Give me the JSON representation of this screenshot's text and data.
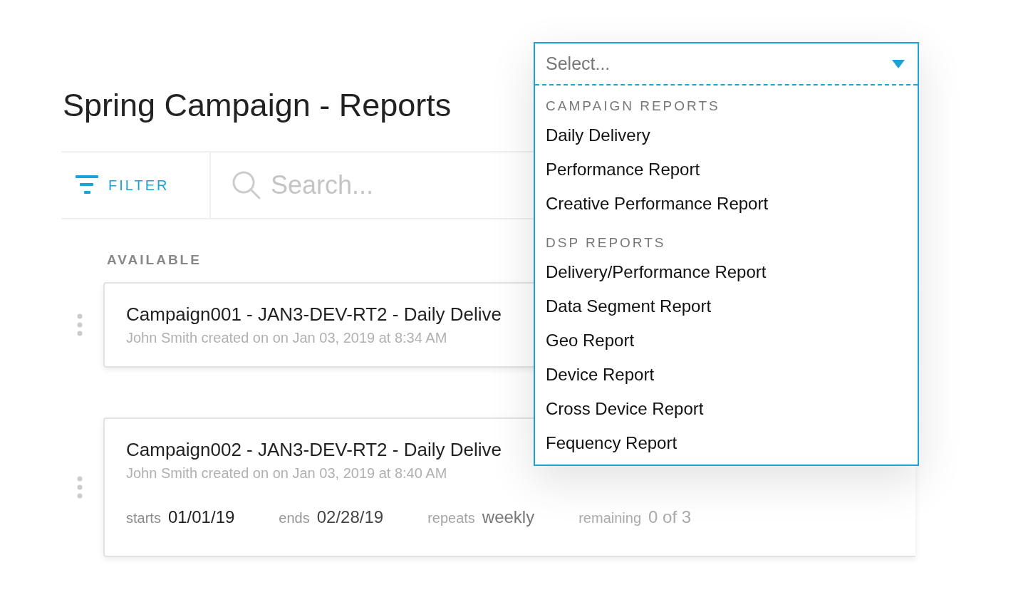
{
  "page": {
    "title": "Spring Campaign - Reports"
  },
  "toolbar": {
    "filter_label": "FILTER",
    "search": {
      "placeholder": "Search..."
    }
  },
  "section_label": "AVAILABLE",
  "reports": [
    {
      "title": "Campaign001 - JAN3-DEV-RT2 - Daily Delive",
      "meta": "John Smith created on on Jan 03, 2019 at 8:34 AM"
    },
    {
      "title": "Campaign002 - JAN3-DEV-RT2 - Daily Delive",
      "meta": "John Smith created on on Jan 03, 2019 at 8:40 AM",
      "schedule": [
        {
          "label": "starts",
          "value": "01/01/19"
        },
        {
          "label": "ends",
          "value": "02/28/19"
        },
        {
          "label": "repeats",
          "value": "weekly"
        },
        {
          "label": "remaining",
          "value": "0 of 3"
        }
      ]
    }
  ],
  "dropdown": {
    "placeholder": "Select...",
    "open": true,
    "groups": [
      {
        "heading": "CAMPAIGN REPORTS",
        "options": [
          "Daily Delivery",
          "Performance Report",
          "Creative Performance Report"
        ]
      },
      {
        "heading": "DSP REPORTS",
        "options": [
          "Delivery/Performance Report",
          "Data Segment Report",
          "Geo Report",
          "Device Report",
          "Cross Device Report",
          "Fequency Report"
        ]
      }
    ]
  }
}
